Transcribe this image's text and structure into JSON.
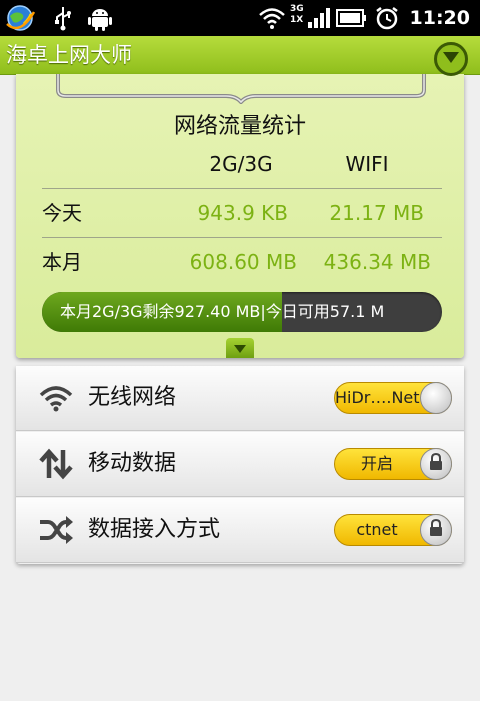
{
  "status_bar": {
    "time": "11:20",
    "network_badge": [
      "3G",
      "1X"
    ],
    "icons": [
      "browser-globe-icon",
      "usb-icon",
      "android-icon",
      "wifi-icon",
      "signal-icon",
      "battery-icon",
      "alarm-icon"
    ]
  },
  "app": {
    "title": "海卓上网大师",
    "accent_color": "#8fbe1c"
  },
  "stats": {
    "title": "网络流量统计",
    "columns": [
      "2G/3G",
      "WIFI"
    ],
    "rows": [
      {
        "label": "今天",
        "mobile": "943.9 KB",
        "wifi": "21.17 MB"
      },
      {
        "label": "本月",
        "mobile": "608.60 MB",
        "wifi": "436.34 MB"
      }
    ],
    "progress": {
      "text": "本月2G/3G剩余927.40 MB|今日可用57.1 M",
      "fill_fraction": 0.6
    }
  },
  "settings": [
    {
      "label": "无线网络",
      "icon": "wifi-icon",
      "toggle": "HiDr….Net",
      "locked": false
    },
    {
      "label": "移动数据",
      "icon": "mobile-data-arrows-icon",
      "toggle": "开启",
      "locked": true
    },
    {
      "label": "数据接入方式",
      "icon": "shuffle-icon",
      "toggle": "ctnet",
      "locked": true
    }
  ]
}
